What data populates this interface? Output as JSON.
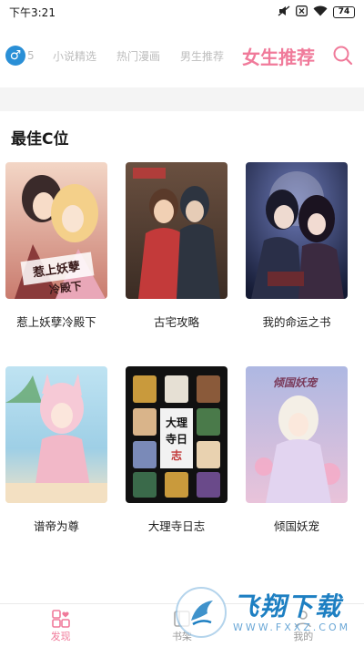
{
  "status_bar": {
    "time": "下午3:21",
    "icons": [
      "mute-icon",
      "close-box-icon",
      "wifi-icon"
    ],
    "battery": "74"
  },
  "tab_bar": {
    "gender_icon": "male-symbol-icon",
    "partial_tab": "5",
    "tabs": [
      {
        "label": "小说精选",
        "active": false
      },
      {
        "label": "热门漫画",
        "active": false
      },
      {
        "label": "男生推荐",
        "active": false
      },
      {
        "label": "女生推荐",
        "active": true
      }
    ],
    "search_icon": "search-icon",
    "accent_color": "#f07a9a"
  },
  "section": {
    "title": "最佳C位",
    "items": [
      {
        "title": "惹上妖孽冷殿下",
        "cover_colors": [
          "#e8b9a8",
          "#8a3a3a",
          "#f6dca6"
        ]
      },
      {
        "title": "古宅攻略",
        "cover_colors": [
          "#7a5a44",
          "#c33a3a",
          "#2d3440"
        ]
      },
      {
        "title": "我的命运之书",
        "cover_colors": [
          "#1b2240",
          "#3d4a7a",
          "#c9c9d8"
        ]
      },
      {
        "title": "谱帝为尊",
        "cover_colors": [
          "#a9d6ea",
          "#f2b8c8",
          "#f6e2c4"
        ]
      },
      {
        "title": "大理寺日志",
        "cover_colors": [
          "#111111",
          "#c99a3c",
          "#f2f2f2"
        ]
      },
      {
        "title": "倾国妖宠",
        "cover_colors": [
          "#b9c2e6",
          "#e9c3da",
          "#f4efe6"
        ]
      }
    ]
  },
  "bottom_nav": {
    "items": [
      {
        "label": "发现",
        "icon": "discover-icon",
        "active": true
      },
      {
        "label": "书架",
        "icon": "bookshelf-icon",
        "active": false
      },
      {
        "label": "我的",
        "icon": "profile-icon",
        "active": false
      }
    ]
  },
  "watermark": {
    "main": "飞翔下载",
    "sub": "WWW.FXXZ.COM"
  }
}
